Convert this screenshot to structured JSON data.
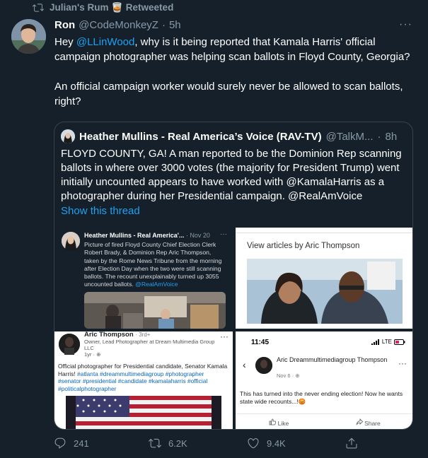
{
  "retweet_bar": {
    "text": "Julian's Rum 🥃 Retweeted",
    "icon": "retweet-icon"
  },
  "tweet": {
    "name": "Ron",
    "handle": "@CodeMonkeyZ",
    "separator": "·",
    "time": "5h",
    "more": "···",
    "para1_prefix": "Hey ",
    "para1_mention": "@LLinWood",
    "para1_rest": ", why is it being reported that Kamala Harris' official campaign photographer was helping scan ballots in Floyd County, Georgia?",
    "para2": "An official campaign worker would surely never be allowed to scan ballots, right?"
  },
  "quote": {
    "name": "Heather Mullins - Real America’s Voice (RAV-TV)",
    "handle": "@TalkM...",
    "separator": "·",
    "time": "8h",
    "text": "FLOYD COUNTY, GA! A man reported to be the Dominion Rep scanning ballots in where over 3000 votes (the majority for President Trump) went initially uncounted appears to have worked with @KamalaHarris as a photographer during her Presidential campaign. @RealAmVoice",
    "show_thread": "Show this thread"
  },
  "images": {
    "img1": {
      "name": "Heather Mullins - Real America'...",
      "date": "· Nov 20",
      "dots": "···",
      "text": "Picture of fired Floyd County Chief Election Clerk Robert Brady, & Dominion Rep Aric Thompson, taken by the Rome News Tribune from the morning after Election Day when the two were still scanning ballots. The recount unexplainably turned up 3055 uncounted ballots.",
      "link": "@RealAmVoice"
    },
    "img2": {
      "label": "View articles by Aric Thompson"
    },
    "img3": {
      "name": "Aric Thompson",
      "degree": "· 3rd+",
      "dots": "···",
      "sub": "Owner, Lead Photographer at Dream Multimedia Group LLC",
      "age": "1yr · ⊕",
      "text": "Official photographer for Presidential candidate, Senator Kamala Harris!",
      "hashtags": "#atlanta #dreammultimediagroup #photographer #senator #presidential #candidate #kamalaharris #official #politicalphotographer"
    },
    "img4": {
      "time": "11:45",
      "status": "LTE",
      "name": "Aric Dreammultimediagroup Thompson",
      "date": "Nov 6 · ⊕",
      "dots": "···",
      "text": "This has turned into the never ending election! Now he wants state wide recounts...!😡",
      "like": "Like",
      "share": "Share"
    }
  },
  "actions": {
    "replies": "241",
    "retweets": "6.2K",
    "likes": "9.4K"
  }
}
